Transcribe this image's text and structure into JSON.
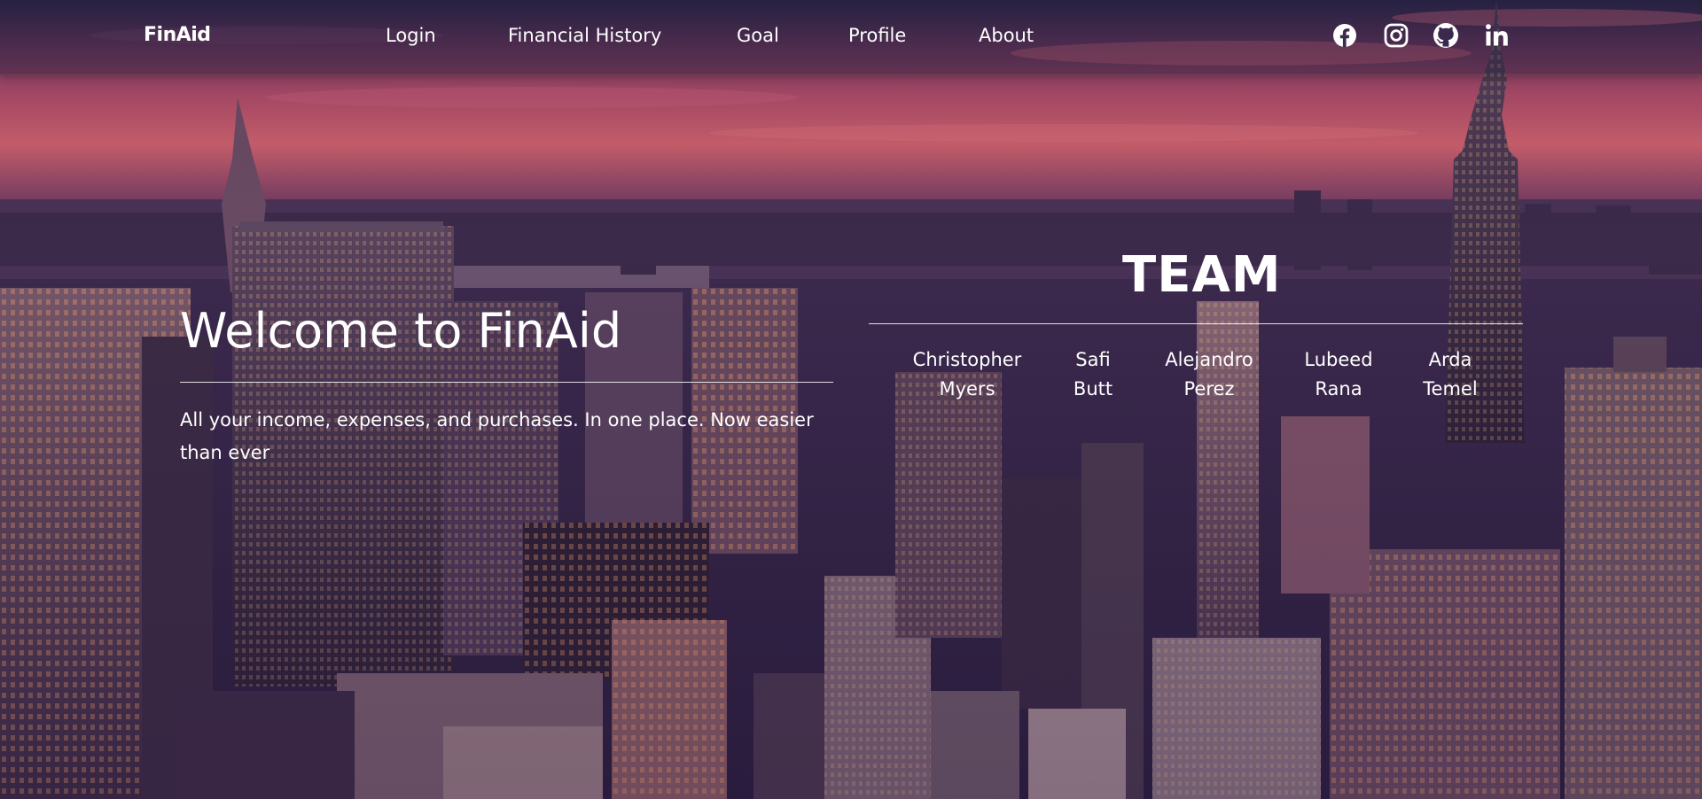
{
  "brand": "FinAid",
  "nav": {
    "links": [
      {
        "label": "Login"
      },
      {
        "label": "Financial History"
      },
      {
        "label": "Goal"
      },
      {
        "label": "Profile"
      },
      {
        "label": "About"
      }
    ],
    "social": [
      "facebook-icon",
      "instagram-icon",
      "github-icon",
      "linkedin-icon"
    ]
  },
  "hero": {
    "title": "Welcome to FinAid",
    "tagline": "All your income, expenses, and purchases. In one place. Now easier than ever"
  },
  "team": {
    "title": "TEAM",
    "members": [
      {
        "first": "Christopher",
        "last": "Myers"
      },
      {
        "first": "Safi",
        "last": "Butt"
      },
      {
        "first": "Alejandro",
        "last": "Perez"
      },
      {
        "first": "Lubeed",
        "last": "Rana"
      },
      {
        "first": "Arda",
        "last": "Temel"
      }
    ]
  },
  "colors": {
    "text": "#ffffff",
    "sky_top": "#3a2a4f",
    "sky_glow": "#c85c6c",
    "city": "#2c2140"
  }
}
